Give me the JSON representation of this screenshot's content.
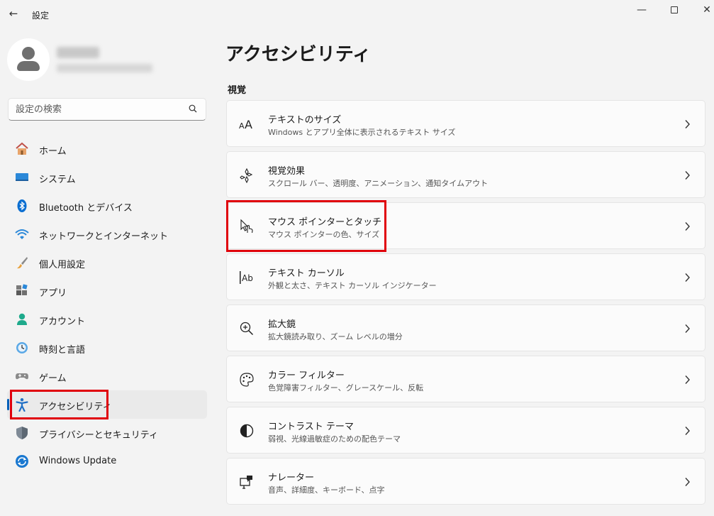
{
  "window": {
    "title": "設定",
    "back_label": "←",
    "min_label": "—",
    "close_label": "✕"
  },
  "search": {
    "placeholder": "設定の検索"
  },
  "sidebar": {
    "items": [
      {
        "label": "ホーム",
        "icon": "home-icon"
      },
      {
        "label": "システム",
        "icon": "system-icon"
      },
      {
        "label": "Bluetooth とデバイス",
        "icon": "bluetooth-icon"
      },
      {
        "label": "ネットワークとインターネット",
        "icon": "wifi-icon"
      },
      {
        "label": "個人用設定",
        "icon": "brush-icon"
      },
      {
        "label": "アプリ",
        "icon": "apps-icon"
      },
      {
        "label": "アカウント",
        "icon": "account-icon"
      },
      {
        "label": "時刻と言語",
        "icon": "time-language-icon"
      },
      {
        "label": "ゲーム",
        "icon": "gamepad-icon"
      },
      {
        "label": "アクセシビリティ",
        "icon": "accessibility-icon",
        "active": true
      },
      {
        "label": "プライバシーとセキュリティ",
        "icon": "shield-icon"
      },
      {
        "label": "Windows Update",
        "icon": "update-icon"
      }
    ]
  },
  "main": {
    "title": "アクセシビリティ",
    "section": "視覚",
    "cards": [
      {
        "title": "テキストのサイズ",
        "desc": "Windows とアプリ全体に表示されるテキスト サイズ",
        "icon": "text-size-icon"
      },
      {
        "title": "視覚効果",
        "desc": "スクロール バー、透明度、アニメーション、通知タイムアウト",
        "icon": "visual-effects-icon"
      },
      {
        "title": "マウス ポインターとタッチ",
        "desc": "マウス ポインターの色、サイズ",
        "icon": "mouse-pointer-icon"
      },
      {
        "title": "テキスト カーソル",
        "desc": "外観と太さ、テキスト カーソル インジケーター",
        "icon": "text-cursor-icon"
      },
      {
        "title": "拡大鏡",
        "desc": "拡大鏡読み取り、ズーム レベルの増分",
        "icon": "magnifier-icon"
      },
      {
        "title": "カラー フィルター",
        "desc": "色覚障害フィルター、グレースケール、反転",
        "icon": "palette-icon"
      },
      {
        "title": "コントラスト テーマ",
        "desc": "弱視、光線過敏症のための配色テーマ",
        "icon": "contrast-icon"
      },
      {
        "title": "ナレーター",
        "desc": "音声、詳細度、キーボード、点字",
        "icon": "narrator-icon"
      }
    ]
  },
  "colors": {
    "accent": "#005fb8",
    "highlight": "#e0000b",
    "background": "#f3f3f3",
    "card": "#fbfbfb"
  }
}
